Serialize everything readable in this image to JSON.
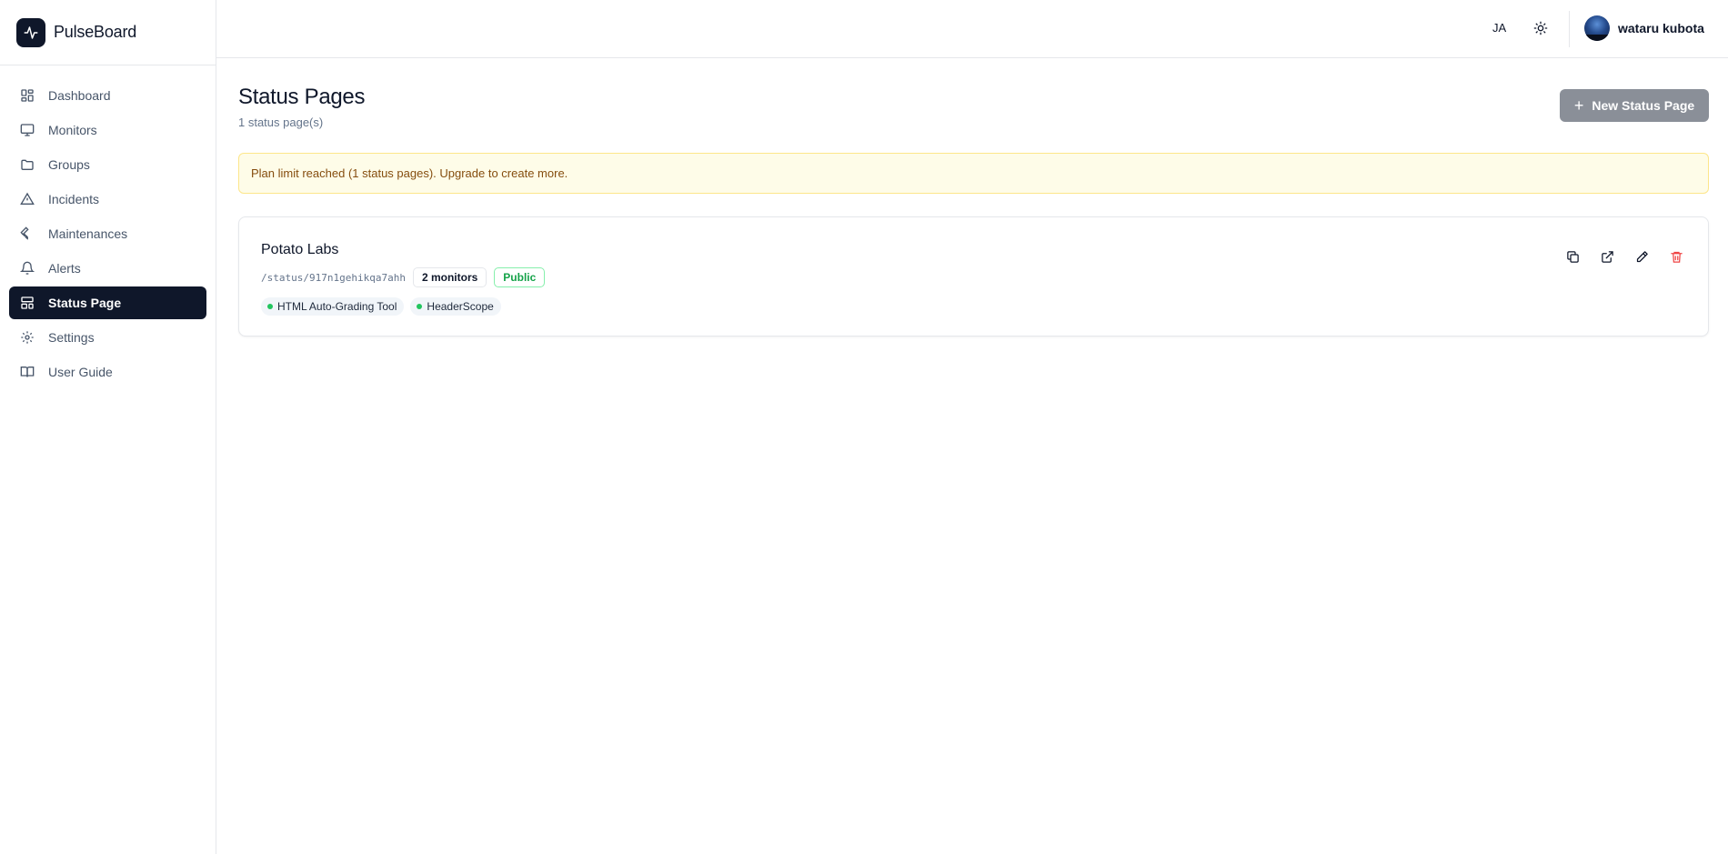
{
  "app": {
    "name": "PulseBoard",
    "logo_icon": "activity-icon"
  },
  "sidebar": {
    "items": [
      {
        "label": "Dashboard",
        "icon": "dashboard-grid-icon",
        "active": false
      },
      {
        "label": "Monitors",
        "icon": "monitor-icon",
        "active": false
      },
      {
        "label": "Groups",
        "icon": "folder-icon",
        "active": false
      },
      {
        "label": "Incidents",
        "icon": "warning-triangle-icon",
        "active": false
      },
      {
        "label": "Maintenances",
        "icon": "wrench-icon",
        "active": false
      },
      {
        "label": "Alerts",
        "icon": "bell-icon",
        "active": false
      },
      {
        "label": "Status Page",
        "icon": "layout-panel-icon",
        "active": true
      },
      {
        "label": "Settings",
        "icon": "gear-icon",
        "active": false
      },
      {
        "label": "User Guide",
        "icon": "book-icon",
        "active": false
      }
    ]
  },
  "header": {
    "language": "JA",
    "theme_icon": "sun-icon",
    "user_name": "wataru kubota"
  },
  "page": {
    "title": "Status Pages",
    "subtitle": "1 status page(s)",
    "new_button_label": "New Status Page",
    "notice": "Plan limit reached (1 status pages). Upgrade to create more."
  },
  "status_pages": [
    {
      "name": "Potato Labs",
      "slug": "/status/917n1gehikqa7ahh",
      "monitor_count_label": "2 monitors",
      "visibility": "Public",
      "monitors": [
        {
          "name": "HTML Auto-Grading Tool",
          "status": "up"
        },
        {
          "name": "HeaderScope",
          "status": "up"
        }
      ]
    }
  ],
  "colors": {
    "primary": "#0f172a",
    "muted_button": "#8a8f98",
    "notice_bg": "#fefce8",
    "notice_text": "#854d0e",
    "success": "#22c55e",
    "danger": "#ef4444"
  }
}
